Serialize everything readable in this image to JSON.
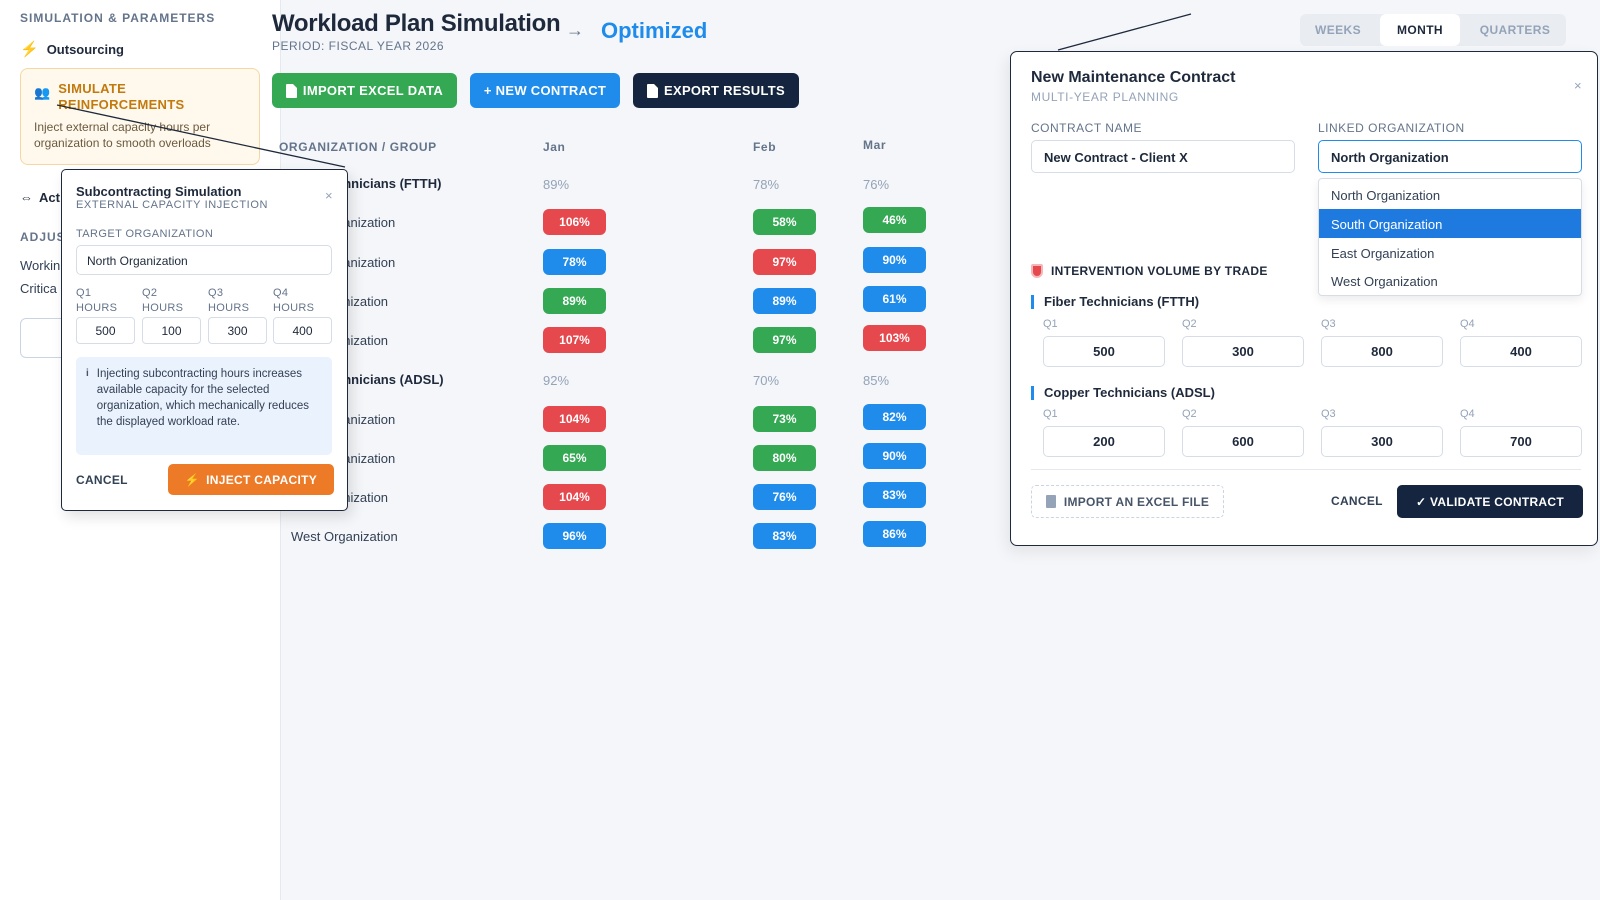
{
  "sidebar": {
    "section_title": "SIMULATION & PARAMETERS",
    "outsourcing_label": "Outsourcing",
    "reinforcement": {
      "title_line1": "SIMULATE",
      "title_line2": "REINFORCEMENTS",
      "description": "Inject external capacity hours per organization to smooth overloads"
    },
    "actions_label": "Act",
    "adjust_label": "ADJUS",
    "working_label": "Workin",
    "critical_label": "Critica"
  },
  "header": {
    "title": "Workload Plan Simulation",
    "period": "PERIOD: FISCAL YEAR 2026",
    "status": "Optimized"
  },
  "toolbar": {
    "import_label": "IMPORT EXCEL DATA",
    "new_contract_label": "+ NEW CONTRACT",
    "export_label": "EXPORT RESULTS"
  },
  "view_switch": {
    "options": [
      "WEEKS",
      "MONTH",
      "QUARTERS"
    ],
    "selected": "MONTH"
  },
  "table": {
    "headers": [
      "ORGANIZATION / GROUP",
      "Jan",
      "Feb",
      "Mar"
    ],
    "rows": [
      {
        "label": "chnicians (FTTH)",
        "type": "group",
        "cells": [
          "89%",
          "78%",
          "76%"
        ]
      },
      {
        "label": "ganization",
        "type": "org",
        "cells": [
          "106%",
          "58%",
          "46%"
        ],
        "status": [
          "red",
          "green",
          "green"
        ]
      },
      {
        "label": "ganization",
        "type": "org",
        "cells": [
          "78%",
          "97%",
          "90%"
        ],
        "status": [
          "blue",
          "red",
          "blue"
        ]
      },
      {
        "label": "anization",
        "type": "org",
        "cells": [
          "89%",
          "89%",
          "61%"
        ],
        "status": [
          "green",
          "blue",
          "blue"
        ]
      },
      {
        "label": "anization",
        "type": "org",
        "cells": [
          "107%",
          "97%",
          "103%"
        ],
        "status": [
          "red",
          "green",
          "red"
        ]
      },
      {
        "label": "chnicians (ADSL)",
        "type": "group",
        "cells": [
          "92%",
          "70%",
          "85%"
        ]
      },
      {
        "label": "ganization",
        "type": "org",
        "cells": [
          "104%",
          "73%",
          "82%"
        ],
        "status": [
          "red",
          "green",
          "blue"
        ]
      },
      {
        "label": "ganization",
        "type": "org",
        "cells": [
          "65%",
          "80%",
          "90%"
        ],
        "status": [
          "green",
          "green",
          "blue"
        ]
      },
      {
        "label": "anization",
        "type": "org",
        "cells": [
          "104%",
          "76%",
          "83%"
        ],
        "status": [
          "red",
          "blue",
          "blue"
        ]
      },
      {
        "label": "West Organization",
        "type": "org",
        "cells": [
          "96%",
          "83%",
          "86%"
        ],
        "status": [
          "blue",
          "blue",
          "blue"
        ]
      }
    ]
  },
  "subcontracting": {
    "title": "Subcontracting Simulation",
    "subtitle": "EXTERNAL CAPACITY INJECTION",
    "close": "×",
    "target_label": "TARGET ORGANIZATION",
    "target_value": "North Organization",
    "quarters": [
      {
        "line1": "Q1",
        "line2": "HOURS",
        "value": "500"
      },
      {
        "line1": "Q2",
        "line2": "HOURS",
        "value": "100"
      },
      {
        "line1": "Q3",
        "line2": "HOURS",
        "value": "300"
      },
      {
        "line1": "Q4",
        "line2": "HOURS",
        "value": "400"
      }
    ],
    "info_icon": "i",
    "info_text": "Injecting subcontracting hours increases available capacity for the selected organization, which mechanically reduces the displayed workload rate.",
    "cancel_label": "CANCEL",
    "inject_label": "INJECT CAPACITY"
  },
  "contract": {
    "title": "New Maintenance Contract",
    "subtitle": "MULTI-YEAR PLANNING",
    "close": "×",
    "name_label": "CONTRACT NAME",
    "name_value": "New Contract - Client X",
    "org_label": "LINKED ORGANIZATION",
    "org_value": "North Organization",
    "org_options": [
      "North Organization",
      "South Organization",
      "East Organization",
      "West Organization"
    ],
    "org_highlighted": "South Organization",
    "volume_title": "INTERVENTION VOLUME BY TRADE",
    "trades": [
      {
        "name": "Fiber Technicians (FTTH)",
        "quarters": [
          "Q1",
          "Q2",
          "Q3",
          "Q4"
        ],
        "values": [
          "500",
          "300",
          "800",
          "400"
        ]
      },
      {
        "name": "Copper Technicians (ADSL)",
        "quarters": [
          "Q1",
          "Q2",
          "Q3",
          "Q4"
        ],
        "values": [
          "200",
          "600",
          "300",
          "700"
        ]
      }
    ],
    "import_label": "IMPORT AN EXCEL FILE",
    "cancel_label": "CANCEL",
    "validate_label": "✓ VALIDATE CONTRACT"
  },
  "colors": {
    "red": "#e5484d",
    "green": "#34a853",
    "blue": "#1f8ceb",
    "navy": "#15253f",
    "orange": "#ec7a26"
  }
}
